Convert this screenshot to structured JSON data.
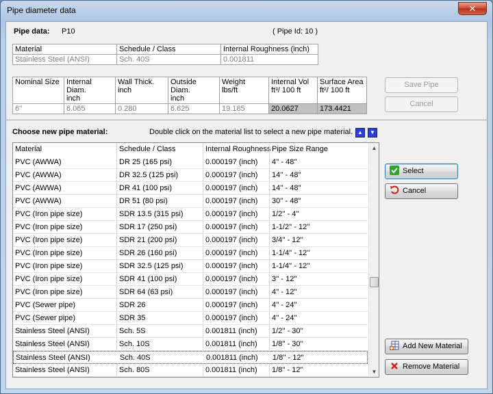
{
  "window": {
    "title": "Pipe diameter data",
    "close_glyph": "✕"
  },
  "pipe": {
    "label": "Pipe data:",
    "name": "P10",
    "id_text": "( Pipe Id: 10 )"
  },
  "material_table": {
    "headers": [
      "Material",
      "Schedule / Class",
      "Internal Roughness (inch)"
    ],
    "values": [
      "Stainless Steel (ANSI)",
      "Sch.  40S",
      "0.001811"
    ]
  },
  "size_table": {
    "headers": [
      "Nominal Size",
      "Internal Diam.\ninch",
      "Wall Thick.\ninch",
      "Outside Diam.\ninch",
      "Weight\nlbs/ft",
      "Internal Vol\nft³/ 100 ft",
      "Surface Area\nft²/ 100 ft"
    ],
    "values": [
      "6''",
      "6.065",
      "0.280",
      "6.625",
      "19.185",
      "20.0627",
      "173.4421"
    ]
  },
  "buttons": {
    "save_pipe": "Save Pipe",
    "cancel_top": "Cancel",
    "select": "Select",
    "cancel": "Cancel",
    "add_material": "Add New Material",
    "remove_material": "Remove Material"
  },
  "choose": {
    "label": "Choose new pipe material:",
    "hint": "Double click on the material list to select a new pipe material."
  },
  "list": {
    "headers": [
      "Material",
      "Schedule / Class",
      "Internal Roughness",
      "Pipe Size Range"
    ],
    "rows": [
      [
        "PVC (AWWA)",
        "DR 25 (165 psi)",
        "0.000197 (inch)",
        "4'' - 48''"
      ],
      [
        "PVC (AWWA)",
        "DR 32.5 (125 psi)",
        "0.000197 (inch)",
        "14'' - 48''"
      ],
      [
        "PVC (AWWA)",
        "DR 41 (100 psi)",
        "0.000197 (inch)",
        "14'' - 48''"
      ],
      [
        "PVC (AWWA)",
        "DR 51 (80 psi)",
        "0.000197 (inch)",
        "30'' - 48''"
      ],
      [
        "PVC (Iron pipe size)",
        "SDR 13.5 (315 psi)",
        "0.000197 (inch)",
        "1/2'' - 4''"
      ],
      [
        "PVC (Iron pipe size)",
        "SDR 17 (250 psi)",
        "0.000197 (inch)",
        "1-1/2'' - 12''"
      ],
      [
        "PVC (Iron pipe size)",
        "SDR 21 (200 psi)",
        "0.000197 (inch)",
        "3/4'' - 12''"
      ],
      [
        "PVC (Iron pipe size)",
        "SDR 26 (160 psi)",
        "0.000197 (inch)",
        "1-1/4'' - 12''"
      ],
      [
        "PVC (Iron pipe size)",
        "SDR 32.5 (125 psi)",
        "0.000197 (inch)",
        "1-1/4'' - 12''"
      ],
      [
        "PVC (Iron pipe size)",
        "SDR 41 (100 psi)",
        "0.000197 (inch)",
        "3'' - 12''"
      ],
      [
        "PVC (Iron pipe size)",
        "SDR 64 (63 psi)",
        "0.000197 (inch)",
        "4'' - 12''"
      ],
      [
        "PVC (Sewer pipe)",
        "SDR 26",
        "0.000197 (inch)",
        "4'' - 24''"
      ],
      [
        "PVC (Sewer pipe)",
        "SDR 35",
        "0.000197 (inch)",
        "4'' - 24''"
      ],
      [
        "Stainless Steel (ANSI)",
        "Sch.   5S",
        "0.001811 (inch)",
        "1/2'' - 30''"
      ],
      [
        "Stainless Steel (ANSI)",
        "Sch.  10S",
        "0.001811 (inch)",
        "1/8'' - 30''"
      ],
      [
        "Stainless Steel (ANSI)",
        "Sch.  40S",
        "0.001811 (inch)",
        "1/8'' - 12''"
      ],
      [
        "Stainless Steel (ANSI)",
        "Sch.  80S",
        "0.001811 (inch)",
        "1/8'' - 12''"
      ]
    ],
    "selected_index": 15
  },
  "icons": {
    "select": "check-icon",
    "cancel": "undo-icon",
    "add": "add-table-icon",
    "remove": "delete-x-icon",
    "up": "arrow-up-icon",
    "down": "arrow-down-icon"
  }
}
